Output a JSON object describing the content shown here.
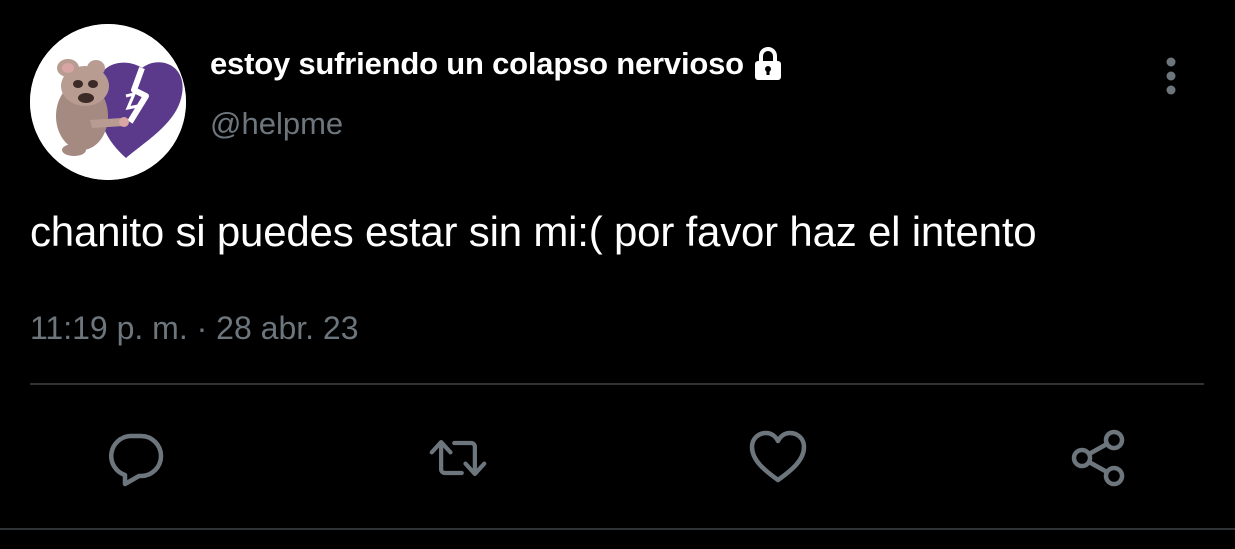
{
  "tweet": {
    "display_name": "estoy sufriendo un colapso nervioso",
    "handle": "@helpme",
    "protected": true,
    "text": "chanito si puedes estar sin mi:( por favor haz el intento",
    "timestamp": "11:19 p. m. · 28 abr. 23"
  },
  "icons": {
    "avatar": "avatar-image",
    "lock": "lock-icon",
    "more": "more-vertical-icon",
    "reply": "reply-icon",
    "retweet": "retweet-icon",
    "like": "heart-icon",
    "share": "share-icon"
  },
  "colors": {
    "background": "#000000",
    "text_primary": "#ffffff",
    "text_secondary": "#6e767d",
    "divider": "#2f3336",
    "icon": "#6e767d"
  }
}
